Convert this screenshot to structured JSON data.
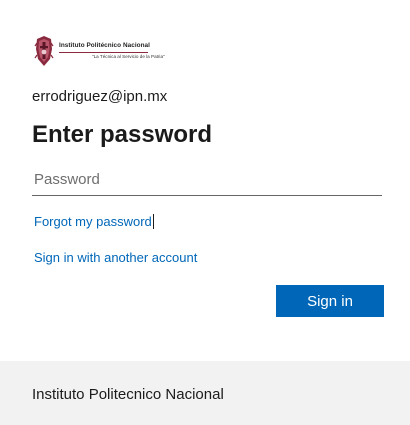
{
  "brand": {
    "logo_name": "Instituto Politécnico Nacional",
    "logo_motto": "\"La Técnica al Servicio de la Patria\"",
    "accent_color": "#8a2a3f"
  },
  "account": {
    "identity": "errodriguez@ipn.mx"
  },
  "main": {
    "title": "Enter password",
    "password_field": {
      "value": "",
      "placeholder": "Password"
    },
    "forgot_link": "Forgot my password",
    "other_account_link": "Sign in with another account",
    "sign_in_button": "Sign in",
    "button_color": "#0067b8",
    "link_color": "#0067b8"
  },
  "footer": {
    "text": "Instituto Politecnico Nacional",
    "background": "#f2f2f2"
  },
  "icons": {
    "logo": "ipn-seal-icon"
  }
}
